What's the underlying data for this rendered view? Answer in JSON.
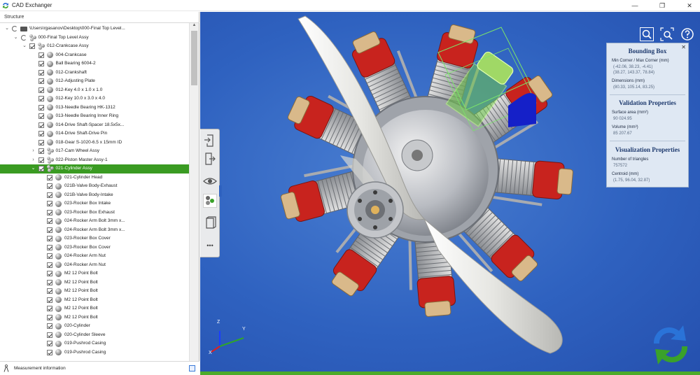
{
  "window": {
    "title": "CAD Exchanger",
    "minimize": "—",
    "maximize": "❐",
    "close": "✕"
  },
  "structure": {
    "header": "Structure",
    "items": [
      {
        "label": "\\Users\\rgasanov\\Desktop\\000-Final Top Level...",
        "kind": "folder",
        "level": 0,
        "expander": "⌄",
        "check": "spin",
        "selected": false
      },
      {
        "label": "000-Final Top Level Assy",
        "kind": "asm",
        "level": 1,
        "expander": "⌄",
        "check": "spin",
        "selected": false
      },
      {
        "label": "012-Crankcase Assy",
        "kind": "asm",
        "level": 2,
        "expander": "⌄",
        "check": "checked",
        "selected": false
      },
      {
        "label": "004-Crankcase",
        "kind": "part",
        "level": 3,
        "expander": "",
        "check": "checked",
        "selected": false
      },
      {
        "label": "Ball Bearing 6004-2",
        "kind": "part",
        "level": 3,
        "expander": "",
        "check": "checked",
        "selected": false
      },
      {
        "label": "012-Crankshaft",
        "kind": "part",
        "level": 3,
        "expander": "",
        "check": "checked",
        "selected": false
      },
      {
        "label": "012-Adjusting Plate",
        "kind": "part",
        "level": 3,
        "expander": "",
        "check": "checked",
        "selected": false
      },
      {
        "label": "012-Key 4.0 x 1.0 x 1.0",
        "kind": "part",
        "level": 3,
        "expander": "",
        "check": "checked",
        "selected": false
      },
      {
        "label": "012-Key 10.0 x 3.0 x 4.0",
        "kind": "part",
        "level": 3,
        "expander": "",
        "check": "checked",
        "selected": false
      },
      {
        "label": "013-Needle Bearing HK-1312",
        "kind": "part",
        "level": 3,
        "expander": "",
        "check": "checked",
        "selected": false
      },
      {
        "label": "013-Needle Bearing Inner Ring",
        "kind": "part",
        "level": 3,
        "expander": "",
        "check": "checked",
        "selected": false
      },
      {
        "label": "014-Drive Shaft-Spacer 18.5x5x...",
        "kind": "part",
        "level": 3,
        "expander": "",
        "check": "checked",
        "selected": false
      },
      {
        "label": "014-Drive Shaft-Drive Pin",
        "kind": "part",
        "level": 3,
        "expander": "",
        "check": "checked",
        "selected": false
      },
      {
        "label": "018-Gear S-1020-6.5 x 15mm ID",
        "kind": "part",
        "level": 3,
        "expander": "",
        "check": "checked",
        "selected": false
      },
      {
        "label": "017-Cam Wheel Assy",
        "kind": "asm",
        "level": 3,
        "expander": "›",
        "check": "checked",
        "selected": false
      },
      {
        "label": "022-Piston Master  Assy-1",
        "kind": "asm",
        "level": 3,
        "expander": "›",
        "check": "checked",
        "selected": false
      },
      {
        "label": "021-Cylinder Assy",
        "kind": "asm",
        "level": 3,
        "expander": "⌄",
        "check": "checked",
        "selected": true
      },
      {
        "label": "021-Cylinder Head",
        "kind": "part",
        "level": 4,
        "expander": "",
        "check": "checked",
        "selected": false
      },
      {
        "label": "021B-Valve Body-Exhaust",
        "kind": "part",
        "level": 4,
        "expander": "",
        "check": "checked",
        "selected": false
      },
      {
        "label": "021B-Valve Body-Intake",
        "kind": "part",
        "level": 4,
        "expander": "",
        "check": "checked",
        "selected": false
      },
      {
        "label": "023-Rocker Box Intake",
        "kind": "part",
        "level": 4,
        "expander": "",
        "check": "checked",
        "selected": false
      },
      {
        "label": "023-Rocker Box Exhaust",
        "kind": "part",
        "level": 4,
        "expander": "",
        "check": "checked",
        "selected": false
      },
      {
        "label": "024-Rocker Arm Bolt 3mm x...",
        "kind": "part",
        "level": 4,
        "expander": "",
        "check": "checked",
        "selected": false
      },
      {
        "label": "024-Rocker Arm Bolt 3mm x...",
        "kind": "part",
        "level": 4,
        "expander": "",
        "check": "checked",
        "selected": false
      },
      {
        "label": "023-Rocker Box Cover",
        "kind": "part",
        "level": 4,
        "expander": "",
        "check": "checked",
        "selected": false
      },
      {
        "label": "023-Rocker Box Cover",
        "kind": "part",
        "level": 4,
        "expander": "",
        "check": "checked",
        "selected": false
      },
      {
        "label": "024-Rocker Arm Nut",
        "kind": "part",
        "level": 4,
        "expander": "",
        "check": "checked",
        "selected": false
      },
      {
        "label": "024-Rocker Arm Nut",
        "kind": "part",
        "level": 4,
        "expander": "",
        "check": "checked",
        "selected": false
      },
      {
        "label": "M2 12 Point Bolt",
        "kind": "part",
        "level": 4,
        "expander": "",
        "check": "checked",
        "selected": false
      },
      {
        "label": "M2 12 Point Bolt",
        "kind": "part",
        "level": 4,
        "expander": "",
        "check": "checked",
        "selected": false
      },
      {
        "label": "M2 12 Point Bolt",
        "kind": "part",
        "level": 4,
        "expander": "",
        "check": "checked",
        "selected": false
      },
      {
        "label": "M2 12 Point Bolt",
        "kind": "part",
        "level": 4,
        "expander": "",
        "check": "checked",
        "selected": false
      },
      {
        "label": "M2 12 Point Bolt",
        "kind": "part",
        "level": 4,
        "expander": "",
        "check": "checked",
        "selected": false
      },
      {
        "label": "M2 12 Point Bolt",
        "kind": "part",
        "level": 4,
        "expander": "",
        "check": "checked",
        "selected": false
      },
      {
        "label": "020-Cylinder",
        "kind": "part",
        "level": 4,
        "expander": "",
        "check": "checked",
        "selected": false
      },
      {
        "label": "020-Cylinder Sleeve",
        "kind": "part",
        "level": 4,
        "expander": "",
        "check": "checked",
        "selected": false
      },
      {
        "label": "019-Pushrod Casing",
        "kind": "part",
        "level": 4,
        "expander": "",
        "check": "checked",
        "selected": false
      },
      {
        "label": "019-Pushrod Casing",
        "kind": "part",
        "level": 4,
        "expander": "",
        "check": "checked",
        "selected": false
      }
    ],
    "measurement_label": "Measurement information"
  },
  "toolbar": {
    "icons": [
      "import-icon",
      "export-icon",
      "eye-icon",
      "structure-icon",
      "book-icon",
      "more-icon"
    ],
    "more_label": "•••"
  },
  "viewport": {
    "axis_labels": {
      "x": "X",
      "y": "Y",
      "z": "Z"
    },
    "colors": {
      "background": "#2f62c0",
      "selected_row": "#3a9b22",
      "engine_red": "#c8231e",
      "propeller": "#e8e8e4"
    }
  },
  "info_panel": {
    "close": "✕",
    "bounding_box": {
      "title": "Bounding Box",
      "minmax_label": "Min Corner / Max Corner (mm)",
      "min": "(-42.06, 38.23, -4.41)",
      "max": "(38.27, 143.37, 78.84)",
      "dims_label": "Dimensions (mm)",
      "dims": "(80.33, 105.14, 83.25)"
    },
    "validation": {
      "title": "Validation Properties",
      "area_label": "Surface area (mm²)",
      "area": "90 024.95",
      "volume_label": "Volume (mm³)",
      "volume": "85 207.67"
    },
    "visualization": {
      "title": "Visualization Properties",
      "triangles_label": "Number of triangles",
      "triangles": "757572",
      "centroid_label": "Centroid (mm)",
      "centroid": "(1.75, 96.04, 32.87)"
    }
  }
}
